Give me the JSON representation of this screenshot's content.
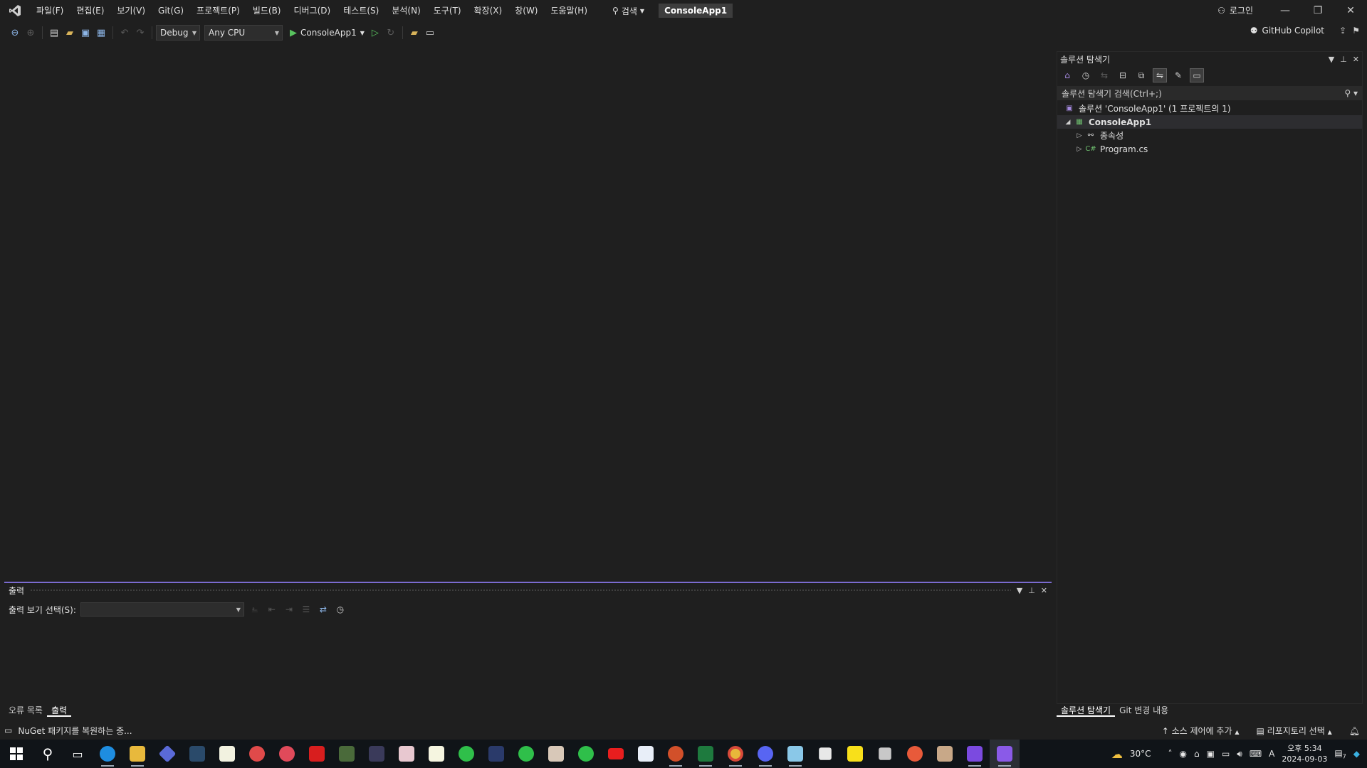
{
  "menu": {
    "items": [
      "파일(F)",
      "편집(E)",
      "보기(V)",
      "Git(G)",
      "프로젝트(P)",
      "빌드(B)",
      "디버그(D)",
      "테스트(S)",
      "분석(N)",
      "도구(T)",
      "확장(X)",
      "창(W)",
      "도움말(H)"
    ],
    "search_label": "검색",
    "solution_title": "ConsoleApp1",
    "login_label": "로그인"
  },
  "toolbar": {
    "config": "Debug",
    "platform": "Any CPU",
    "run_target": "ConsoleApp1",
    "copilot_label": "GitHub Copilot"
  },
  "solution_explorer": {
    "title": "솔루션 탐색기",
    "search_placeholder": "솔루션 탐색기 검색(Ctrl+;)",
    "tree": {
      "solution": "솔루션 'ConsoleApp1' (1 프로젝트의 1)",
      "project": "ConsoleApp1",
      "dependencies": "종속성",
      "program": "Program.cs"
    },
    "tabs": [
      "솔루션 탐색기",
      "Git 변경 내용"
    ]
  },
  "output_panel": {
    "title": "출력",
    "show_output_label": "출력 보기 선택(S):",
    "tabs": [
      "오류 목록",
      "출력"
    ]
  },
  "statusbar": {
    "message": "NuGet 패키지를 복원하는 중...",
    "source_control": "소스 제어에 추가",
    "repository": "리포지토리 선택"
  },
  "taskbar": {
    "temperature": "30°C",
    "time": "오후 5:34",
    "date": "2024-09-03",
    "ime": "A",
    "notification_count": "7"
  },
  "colors": {
    "accent": "#7b6bd0",
    "run_green": "#58c25e",
    "background": "#1f1f1f"
  }
}
